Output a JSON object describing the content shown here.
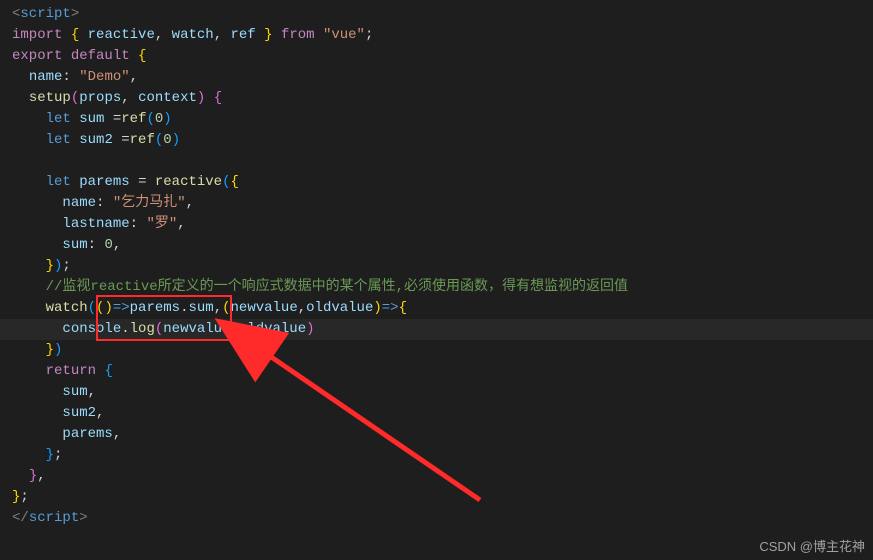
{
  "code": {
    "tag_open_lt": "<",
    "tag_open_gt": ">",
    "tag_close_lt": "</",
    "script_tag": "script",
    "import_kw": "import",
    "lbrace": "{",
    "rbrace": "}",
    "reactive": "reactive",
    "watch": "watch",
    "ref": "ref",
    "from_kw": "from",
    "vue_str": "\"vue\"",
    "semi": ";",
    "export_kw": "export",
    "default_kw": "default",
    "name_prop": "name",
    "colon": ":",
    "demo_str": "\"Demo\"",
    "comma": ",",
    "setup": "setup",
    "lparen": "(",
    "rparen": ")",
    "props": "props",
    "context": "context",
    "let_kw": "let",
    "sum": "sum",
    "sum2": "sum2",
    "eq": "=",
    "zero": "0",
    "parems": "parems",
    "name_str": "\"乞力马扎\"",
    "lastname": "lastname",
    "luo_str": "\"罗\"",
    "sum_prop": "sum",
    "comment_text": "//监视reactive所定义的一个响应式数据中的某个属性,必须使用函数，得有想监视的返回值",
    "arrow": "=>",
    "newvalue": "newvalue",
    "oldvalue": "oldvalue",
    "console": "console",
    "log": "log",
    "dot": ".",
    "return_kw": "return"
  },
  "watermark": "CSDN @博主花神"
}
